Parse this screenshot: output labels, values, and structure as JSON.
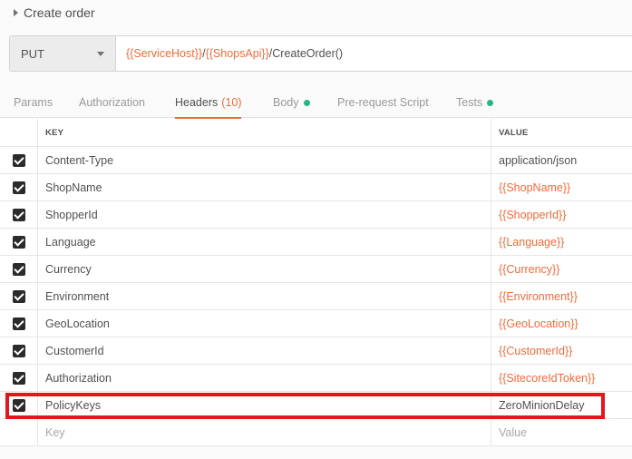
{
  "request": {
    "title": "Create order",
    "method": "PUT",
    "url_parts": [
      {
        "text": "{{ServiceHost}}",
        "var": true
      },
      {
        "text": "/",
        "var": false
      },
      {
        "text": "{{ShopsApi}}",
        "var": true
      },
      {
        "text": "/CreateOrder()",
        "var": false
      }
    ]
  },
  "tabs": [
    {
      "label": "Params"
    },
    {
      "label": "Authorization"
    },
    {
      "label": "Headers",
      "count": "(10)"
    },
    {
      "label": "Body",
      "dot": true
    },
    {
      "label": "Pre-request Script"
    },
    {
      "label": "Tests",
      "dot": true
    }
  ],
  "headers_table": {
    "key_header": "KEY",
    "value_header": "VALUE",
    "rows": [
      {
        "key": "Content-Type",
        "value": "application/json",
        "value_is_var": false,
        "checked": true
      },
      {
        "key": "ShopName",
        "value": "{{ShopName}}",
        "value_is_var": true,
        "checked": true
      },
      {
        "key": "ShopperId",
        "value": "{{ShopperId}}",
        "value_is_var": true,
        "checked": true
      },
      {
        "key": "Language",
        "value": "{{Language}}",
        "value_is_var": true,
        "checked": true
      },
      {
        "key": "Currency",
        "value": "{{Currency}}",
        "value_is_var": true,
        "checked": true
      },
      {
        "key": "Environment",
        "value": "{{Environment}}",
        "value_is_var": true,
        "checked": true
      },
      {
        "key": "GeoLocation",
        "value": "{{GeoLocation}}",
        "value_is_var": true,
        "checked": true
      },
      {
        "key": "CustomerId",
        "value": "{{CustomerId}}",
        "value_is_var": true,
        "checked": true
      },
      {
        "key": "Authorization",
        "value": "{{SitecoreIdToken}}",
        "value_is_var": true,
        "checked": true
      },
      {
        "key": "PolicyKeys",
        "value": "ZeroMinionDelay",
        "value_is_var": false,
        "checked": true
      }
    ],
    "new_row": {
      "key_placeholder": "Key",
      "value_placeholder": "Value"
    }
  },
  "colors": {
    "accent": "#f26b3a",
    "dot_green": "#26b47f",
    "highlight_red": "#e8141b"
  }
}
